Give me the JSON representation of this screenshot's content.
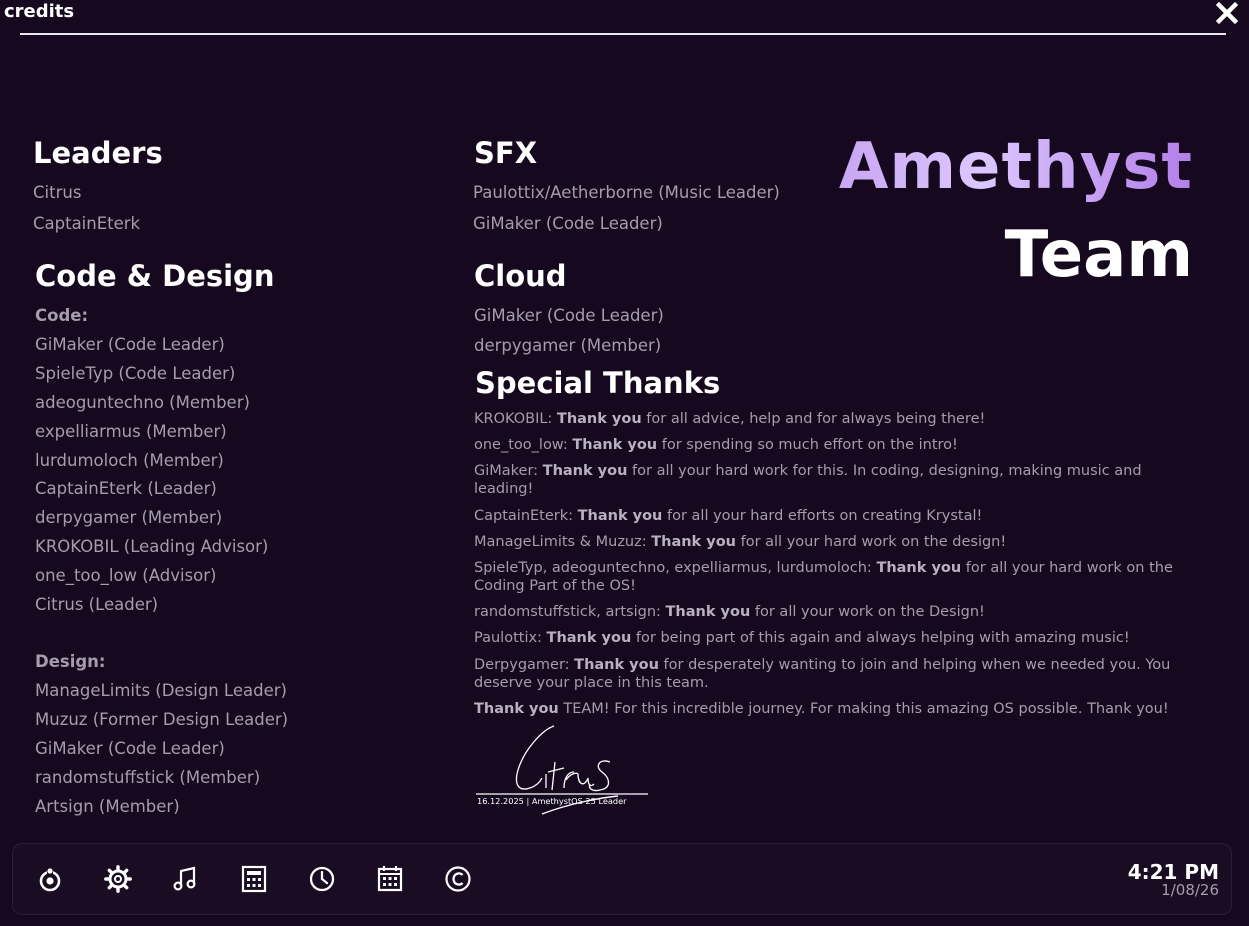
{
  "window": {
    "title": "credits",
    "close_icon": "close-icon"
  },
  "leaders": {
    "title": "Leaders",
    "items": [
      "Citrus",
      "CaptainEterk"
    ]
  },
  "code_design": {
    "title": "Code & Design",
    "code_label": "Code:",
    "code_items": [
      "GiMaker (Code Leader)",
      "SpieleTyp (Code Leader)",
      "adeoguntechno (Member)",
      "expelliarmus (Member)",
      "lurdumoloch (Member)",
      "CaptainEterk (Leader)",
      "derpygamer (Member)",
      "KROKOBIL (Leading Advisor)",
      "one_too_low (Advisor)",
      "Citrus (Leader)"
    ],
    "design_label": "Design:",
    "design_items": [
      "ManageLimits (Design Leader)",
      "Muzuz (Former Design Leader)",
      "GiMaker (Code Leader)",
      "randomstuffstick (Member)",
      "Artsign (Member)"
    ]
  },
  "sfx": {
    "title": "SFX",
    "items": [
      "Paulottix/Aetherborne (Music Leader)",
      "GiMaker (Code Leader)"
    ]
  },
  "cloud": {
    "title": "Cloud",
    "items": [
      "GiMaker (Code Leader)",
      "derpygamer (Member)"
    ]
  },
  "brand": {
    "line1": "Amethyst",
    "line2": "Team"
  },
  "special_thanks": {
    "title": "Special Thanks",
    "items": [
      {
        "name": "KROKOBIL: ",
        "bold": "Thank you",
        "text": " for all advice, help and for always being there!"
      },
      {
        "name": "one_too_low: ",
        "bold": "Thank you",
        "text": " for spending so much effort on the intro!"
      },
      {
        "name": "GiMaker: ",
        "bold": "Thank you",
        "text": " for all your hard work for this. In coding, designing, making music and leading!"
      },
      {
        "name": "CaptainEterk: ",
        "bold": "Thank you",
        "text": " for all your hard efforts on creating Krystal!"
      },
      {
        "name": "ManageLimits & Muzuz: ",
        "bold": "Thank you",
        "text": " for all your hard work on the design!"
      },
      {
        "name": "SpieleTyp, adeoguntechno, expelliarmus, lurdumoloch: ",
        "bold": "Thank you",
        "text": " for all your hard work on the Coding Part of the OS!"
      },
      {
        "name": "randomstuffstick, artsign: ",
        "bold": "Thank you",
        "text": " for all your work on the Design!"
      },
      {
        "name": "Paulottix: ",
        "bold": "Thank you",
        "text": " for being part of this again and always helping with amazing music!"
      },
      {
        "name": "Derpygamer: ",
        "bold": "Thank you",
        "text": " for desperately wanting to join and helping when we needed you. You deserve your place in this team."
      },
      {
        "name": "",
        "bold": "Thank you",
        "text": " TEAM! For this incredible journey. For making this amazing OS possible. Thank you!"
      }
    ]
  },
  "signature": {
    "name": "Citrus",
    "caption": "16.12.2025 | AmethystOS 25 Leader"
  },
  "dock": {
    "icons": [
      "launcher-icon",
      "settings-gear-icon",
      "music-note-icon",
      "calculator-icon",
      "clock-icon",
      "calendar-icon",
      "copyright-icon"
    ]
  },
  "clock": {
    "time": "4:21 PM",
    "date": "1/08/26"
  }
}
